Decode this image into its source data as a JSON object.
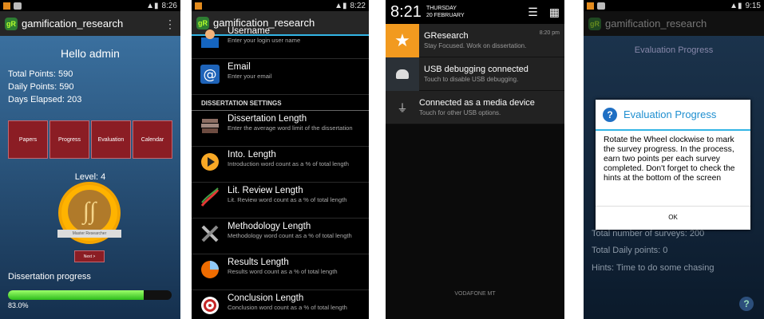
{
  "app_title": "gamification_research",
  "logo_text": "gR",
  "phone1": {
    "status_time": "8:26",
    "greeting": "Hello admin",
    "stats": [
      "Total Points: 590",
      "Daily Points: 590",
      "Days Elapsed: 203"
    ],
    "buttons": [
      "Papers",
      "Progress",
      "Evaluation",
      "Calendar"
    ],
    "level": "Level: 4",
    "badge_label": "Master Researcher",
    "next_button": "Next >",
    "progress_title": "Dissertation progress",
    "progress_fraction": 0.83,
    "progress_text": "83.0%"
  },
  "phone2": {
    "status_time": "8:22",
    "items_top": [
      {
        "title": "Username",
        "subtitle": "Enter your login user name",
        "icon": "user-icon"
      },
      {
        "title": "Email",
        "subtitle": "Enter your email",
        "icon": "email-icon"
      }
    ],
    "section_header": "DISSERTATION SETTINGS",
    "items": [
      {
        "title": "Dissertation Length",
        "subtitle": "Enter the average word limit of the dissertation",
        "icon": "books-icon"
      },
      {
        "title": "Into. Length",
        "subtitle": "Introduction word count as a % of total length",
        "icon": "play-icon"
      },
      {
        "title": "Lit. Review Length",
        "subtitle": "Lit. Review word count as a % of total length",
        "icon": "dna-icon"
      },
      {
        "title": "Methodology Length",
        "subtitle": "Methodology word count as a % of total length",
        "icon": "tools-icon"
      },
      {
        "title": "Results Length",
        "subtitle": "Results word count as a % of total length",
        "icon": "pie-icon"
      },
      {
        "title": "Conclusion Length",
        "subtitle": "Conclusion word count as a % of total length",
        "icon": "target-icon"
      }
    ]
  },
  "phone3": {
    "time": "8:21",
    "day": "THURSDAY",
    "date": "20 FEBRUARY",
    "notifications": [
      {
        "title": "GResearch",
        "subtitle": "Stay Focused. Work on dissertation.",
        "time": "8:20 pm",
        "icon": "star-icon"
      },
      {
        "title": "USB debugging connected",
        "subtitle": "Touch to disable USB debugging.",
        "time": "",
        "icon": "android-icon"
      },
      {
        "title": "Connected as a media device",
        "subtitle": "Touch for other USB options.",
        "time": "",
        "icon": "usb-icon"
      }
    ],
    "carrier": "VODAFONE MT"
  },
  "phone4": {
    "status_time": "9:15",
    "screen_title": "Evaluation Progress",
    "dialog_title": "Evaluation Progress",
    "dialog_body": "Rotate the Wheel clockwise to mark the survey progress. In the process, earn two points per each survey completed. Don't forget to check the hints at the bottom of the screen",
    "dialog_ok": "OK",
    "total_surveys": "Total number of surveys: 200",
    "total_daily": "Total Daily points: 0",
    "hints": "Hints: Time to do some chasing",
    "help": "?"
  }
}
